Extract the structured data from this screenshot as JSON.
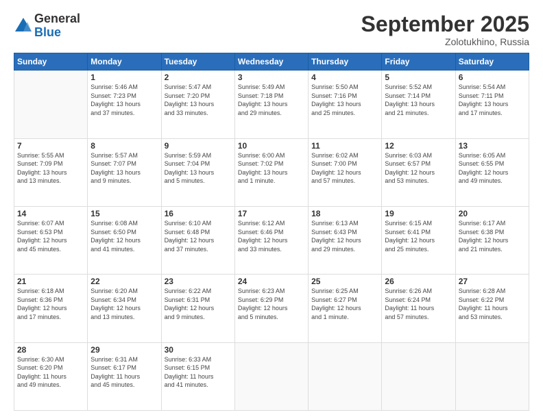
{
  "logo": {
    "general": "General",
    "blue": "Blue"
  },
  "header": {
    "month": "September 2025",
    "location": "Zolotukhino, Russia"
  },
  "days_of_week": [
    "Sunday",
    "Monday",
    "Tuesday",
    "Wednesday",
    "Thursday",
    "Friday",
    "Saturday"
  ],
  "weeks": [
    [
      {
        "day": "",
        "info": ""
      },
      {
        "day": "1",
        "info": "Sunrise: 5:46 AM\nSunset: 7:23 PM\nDaylight: 13 hours\nand 37 minutes."
      },
      {
        "day": "2",
        "info": "Sunrise: 5:47 AM\nSunset: 7:20 PM\nDaylight: 13 hours\nand 33 minutes."
      },
      {
        "day": "3",
        "info": "Sunrise: 5:49 AM\nSunset: 7:18 PM\nDaylight: 13 hours\nand 29 minutes."
      },
      {
        "day": "4",
        "info": "Sunrise: 5:50 AM\nSunset: 7:16 PM\nDaylight: 13 hours\nand 25 minutes."
      },
      {
        "day": "5",
        "info": "Sunrise: 5:52 AM\nSunset: 7:14 PM\nDaylight: 13 hours\nand 21 minutes."
      },
      {
        "day": "6",
        "info": "Sunrise: 5:54 AM\nSunset: 7:11 PM\nDaylight: 13 hours\nand 17 minutes."
      }
    ],
    [
      {
        "day": "7",
        "info": "Sunrise: 5:55 AM\nSunset: 7:09 PM\nDaylight: 13 hours\nand 13 minutes."
      },
      {
        "day": "8",
        "info": "Sunrise: 5:57 AM\nSunset: 7:07 PM\nDaylight: 13 hours\nand 9 minutes."
      },
      {
        "day": "9",
        "info": "Sunrise: 5:59 AM\nSunset: 7:04 PM\nDaylight: 13 hours\nand 5 minutes."
      },
      {
        "day": "10",
        "info": "Sunrise: 6:00 AM\nSunset: 7:02 PM\nDaylight: 13 hours\nand 1 minute."
      },
      {
        "day": "11",
        "info": "Sunrise: 6:02 AM\nSunset: 7:00 PM\nDaylight: 12 hours\nand 57 minutes."
      },
      {
        "day": "12",
        "info": "Sunrise: 6:03 AM\nSunset: 6:57 PM\nDaylight: 12 hours\nand 53 minutes."
      },
      {
        "day": "13",
        "info": "Sunrise: 6:05 AM\nSunset: 6:55 PM\nDaylight: 12 hours\nand 49 minutes."
      }
    ],
    [
      {
        "day": "14",
        "info": "Sunrise: 6:07 AM\nSunset: 6:53 PM\nDaylight: 12 hours\nand 45 minutes."
      },
      {
        "day": "15",
        "info": "Sunrise: 6:08 AM\nSunset: 6:50 PM\nDaylight: 12 hours\nand 41 minutes."
      },
      {
        "day": "16",
        "info": "Sunrise: 6:10 AM\nSunset: 6:48 PM\nDaylight: 12 hours\nand 37 minutes."
      },
      {
        "day": "17",
        "info": "Sunrise: 6:12 AM\nSunset: 6:46 PM\nDaylight: 12 hours\nand 33 minutes."
      },
      {
        "day": "18",
        "info": "Sunrise: 6:13 AM\nSunset: 6:43 PM\nDaylight: 12 hours\nand 29 minutes."
      },
      {
        "day": "19",
        "info": "Sunrise: 6:15 AM\nSunset: 6:41 PM\nDaylight: 12 hours\nand 25 minutes."
      },
      {
        "day": "20",
        "info": "Sunrise: 6:17 AM\nSunset: 6:38 PM\nDaylight: 12 hours\nand 21 minutes."
      }
    ],
    [
      {
        "day": "21",
        "info": "Sunrise: 6:18 AM\nSunset: 6:36 PM\nDaylight: 12 hours\nand 17 minutes."
      },
      {
        "day": "22",
        "info": "Sunrise: 6:20 AM\nSunset: 6:34 PM\nDaylight: 12 hours\nand 13 minutes."
      },
      {
        "day": "23",
        "info": "Sunrise: 6:22 AM\nSunset: 6:31 PM\nDaylight: 12 hours\nand 9 minutes."
      },
      {
        "day": "24",
        "info": "Sunrise: 6:23 AM\nSunset: 6:29 PM\nDaylight: 12 hours\nand 5 minutes."
      },
      {
        "day": "25",
        "info": "Sunrise: 6:25 AM\nSunset: 6:27 PM\nDaylight: 12 hours\nand 1 minute."
      },
      {
        "day": "26",
        "info": "Sunrise: 6:26 AM\nSunset: 6:24 PM\nDaylight: 11 hours\nand 57 minutes."
      },
      {
        "day": "27",
        "info": "Sunrise: 6:28 AM\nSunset: 6:22 PM\nDaylight: 11 hours\nand 53 minutes."
      }
    ],
    [
      {
        "day": "28",
        "info": "Sunrise: 6:30 AM\nSunset: 6:20 PM\nDaylight: 11 hours\nand 49 minutes."
      },
      {
        "day": "29",
        "info": "Sunrise: 6:31 AM\nSunset: 6:17 PM\nDaylight: 11 hours\nand 45 minutes."
      },
      {
        "day": "30",
        "info": "Sunrise: 6:33 AM\nSunset: 6:15 PM\nDaylight: 11 hours\nand 41 minutes."
      },
      {
        "day": "",
        "info": ""
      },
      {
        "day": "",
        "info": ""
      },
      {
        "day": "",
        "info": ""
      },
      {
        "day": "",
        "info": ""
      }
    ]
  ]
}
